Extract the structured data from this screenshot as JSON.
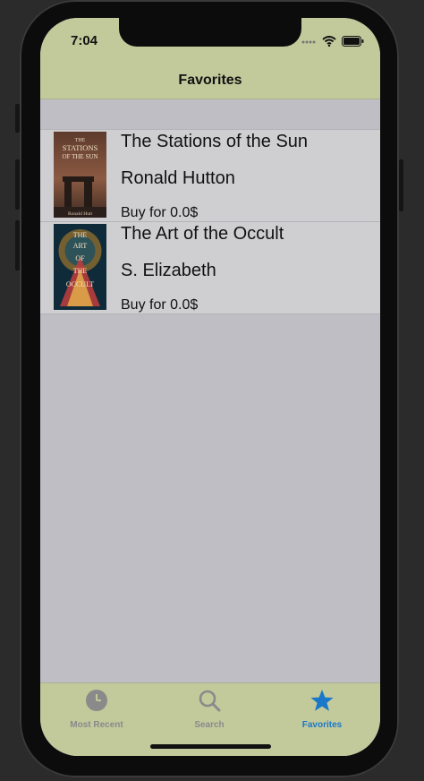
{
  "status_bar": {
    "time": "7:04"
  },
  "navbar": {
    "title": "Favorites"
  },
  "books": [
    {
      "title": "The Stations of the Sun",
      "author": "Ronald Hutton",
      "price": "Buy for 0.0$",
      "cover": {
        "line1": "THE",
        "line2": "STATIONS",
        "line3": "OF THE SUN",
        "author_text": "Ronald Hutt"
      }
    },
    {
      "title": "The Art of the Occult",
      "author": "S. Elizabeth",
      "price": "Buy for 0.0$",
      "cover": {
        "lines": [
          "THE",
          "ART",
          "OF",
          "THE",
          "OCCULT"
        ]
      }
    }
  ],
  "tabbar": {
    "tabs": [
      {
        "label": "Most Recent",
        "icon": "clock-icon",
        "selected": false
      },
      {
        "label": "Search",
        "icon": "magnifier-icon",
        "selected": false
      },
      {
        "label": "Favorites",
        "icon": "star-icon",
        "selected": true
      }
    ]
  },
  "colors": {
    "bar_green": "#c2ca9c",
    "accent_blue": "#1a78c8",
    "inactive_gray": "#8a8a8a",
    "content_bg": "#bebec4"
  }
}
